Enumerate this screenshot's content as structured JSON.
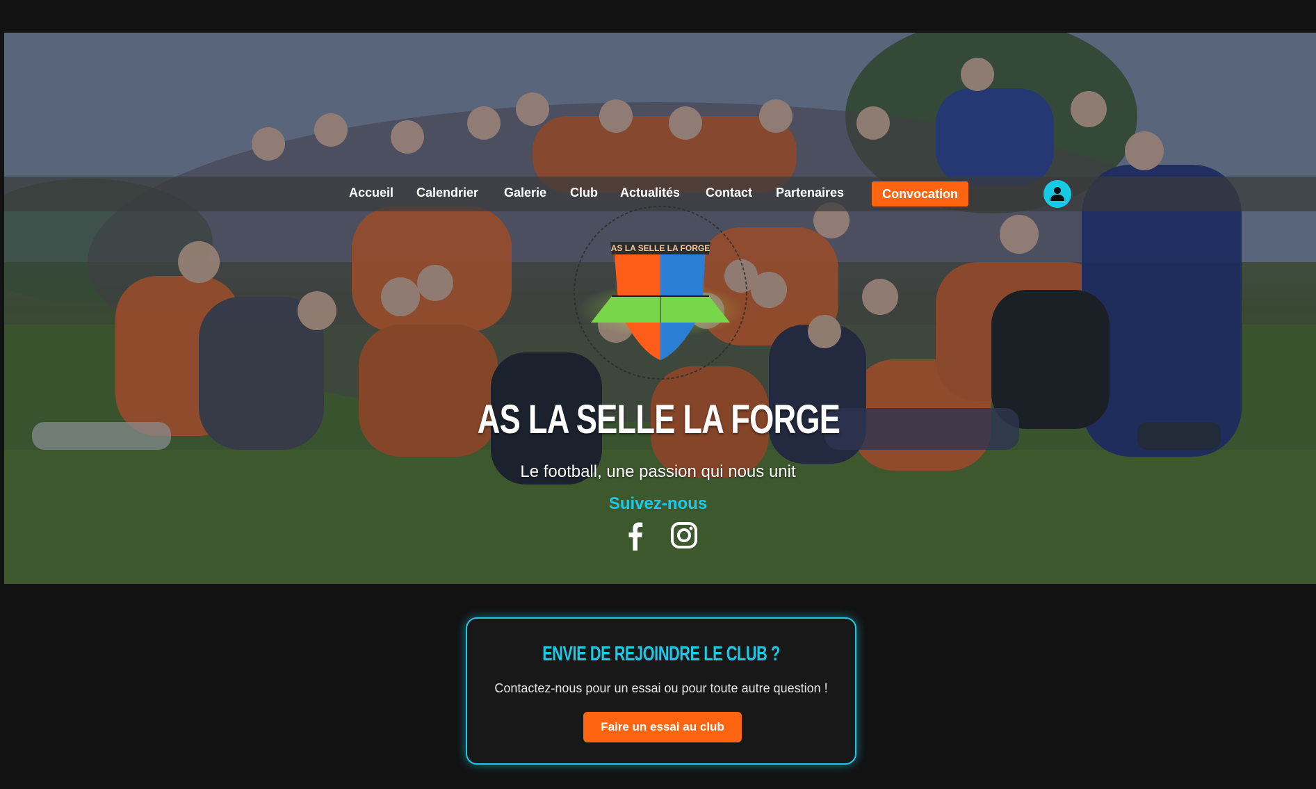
{
  "nav": {
    "items": [
      {
        "label": "Accueil"
      },
      {
        "label": "Calendrier"
      },
      {
        "label": "Galerie"
      },
      {
        "label": "Club"
      },
      {
        "label": "Actualités"
      },
      {
        "label": "Contact"
      },
      {
        "label": "Partenaires"
      }
    ],
    "cta_label": "Convocation",
    "account_icon": "user-icon"
  },
  "hero": {
    "logo_text": "AS LA SELLE LA FORGE",
    "title": "AS LA SELLE LA FORGE",
    "subtitle": "Le football, une passion qui nous unit",
    "follow_label": "Suivez-nous",
    "social_icons": [
      "facebook-icon",
      "instagram-icon"
    ]
  },
  "join": {
    "title": "ENVIE DE REJOINDRE LE CLUB ?",
    "text": "Contactez-nous pour un essai ou pour toute autre question !",
    "button_label": "Faire un essai au club"
  },
  "colors": {
    "accent_orange": "#ff6510",
    "accent_cyan": "#1ec8e8",
    "background": "#121212"
  }
}
